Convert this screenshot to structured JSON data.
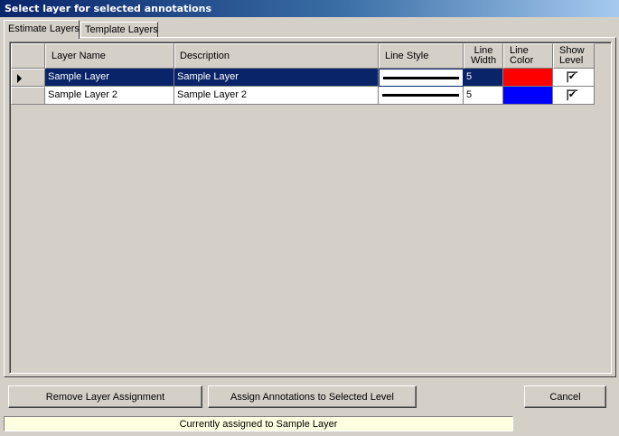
{
  "window": {
    "title": "Select layer for selected annotations"
  },
  "tabs": [
    {
      "label": "Estimate Layers",
      "active": true
    },
    {
      "label": "Template Layers",
      "active": false
    }
  ],
  "grid": {
    "columns": {
      "layer_name": "Layer Name",
      "description": "Description",
      "line_style": "Line Style",
      "line_width_1": "Line",
      "line_width_2": "Width",
      "line_color_1": "Line",
      "line_color_2": "Color",
      "show_level_1": "Show",
      "show_level_2": "Level"
    },
    "rows": [
      {
        "layer_name": "Sample Layer",
        "description": "Sample Layer",
        "line_width": "5",
        "line_color": "#ff0000",
        "show_level": true,
        "selected": true
      },
      {
        "layer_name": "Sample Layer 2",
        "description": "Sample Layer 2",
        "line_width": "5",
        "line_color": "#0000ff",
        "show_level": true,
        "selected": false
      }
    ]
  },
  "buttons": {
    "remove": "Remove Layer Assignment",
    "assign": "Assign Annotations to Selected Level",
    "cancel": "Cancel"
  },
  "status": {
    "text": "Currently assigned to Sample Layer"
  },
  "icons": {
    "current_row": "row-pointer-icon",
    "checkbox": "checkbox-checked-icon"
  },
  "colors": {
    "selection": "#0a246a",
    "status_bg": "#ffffe1"
  }
}
